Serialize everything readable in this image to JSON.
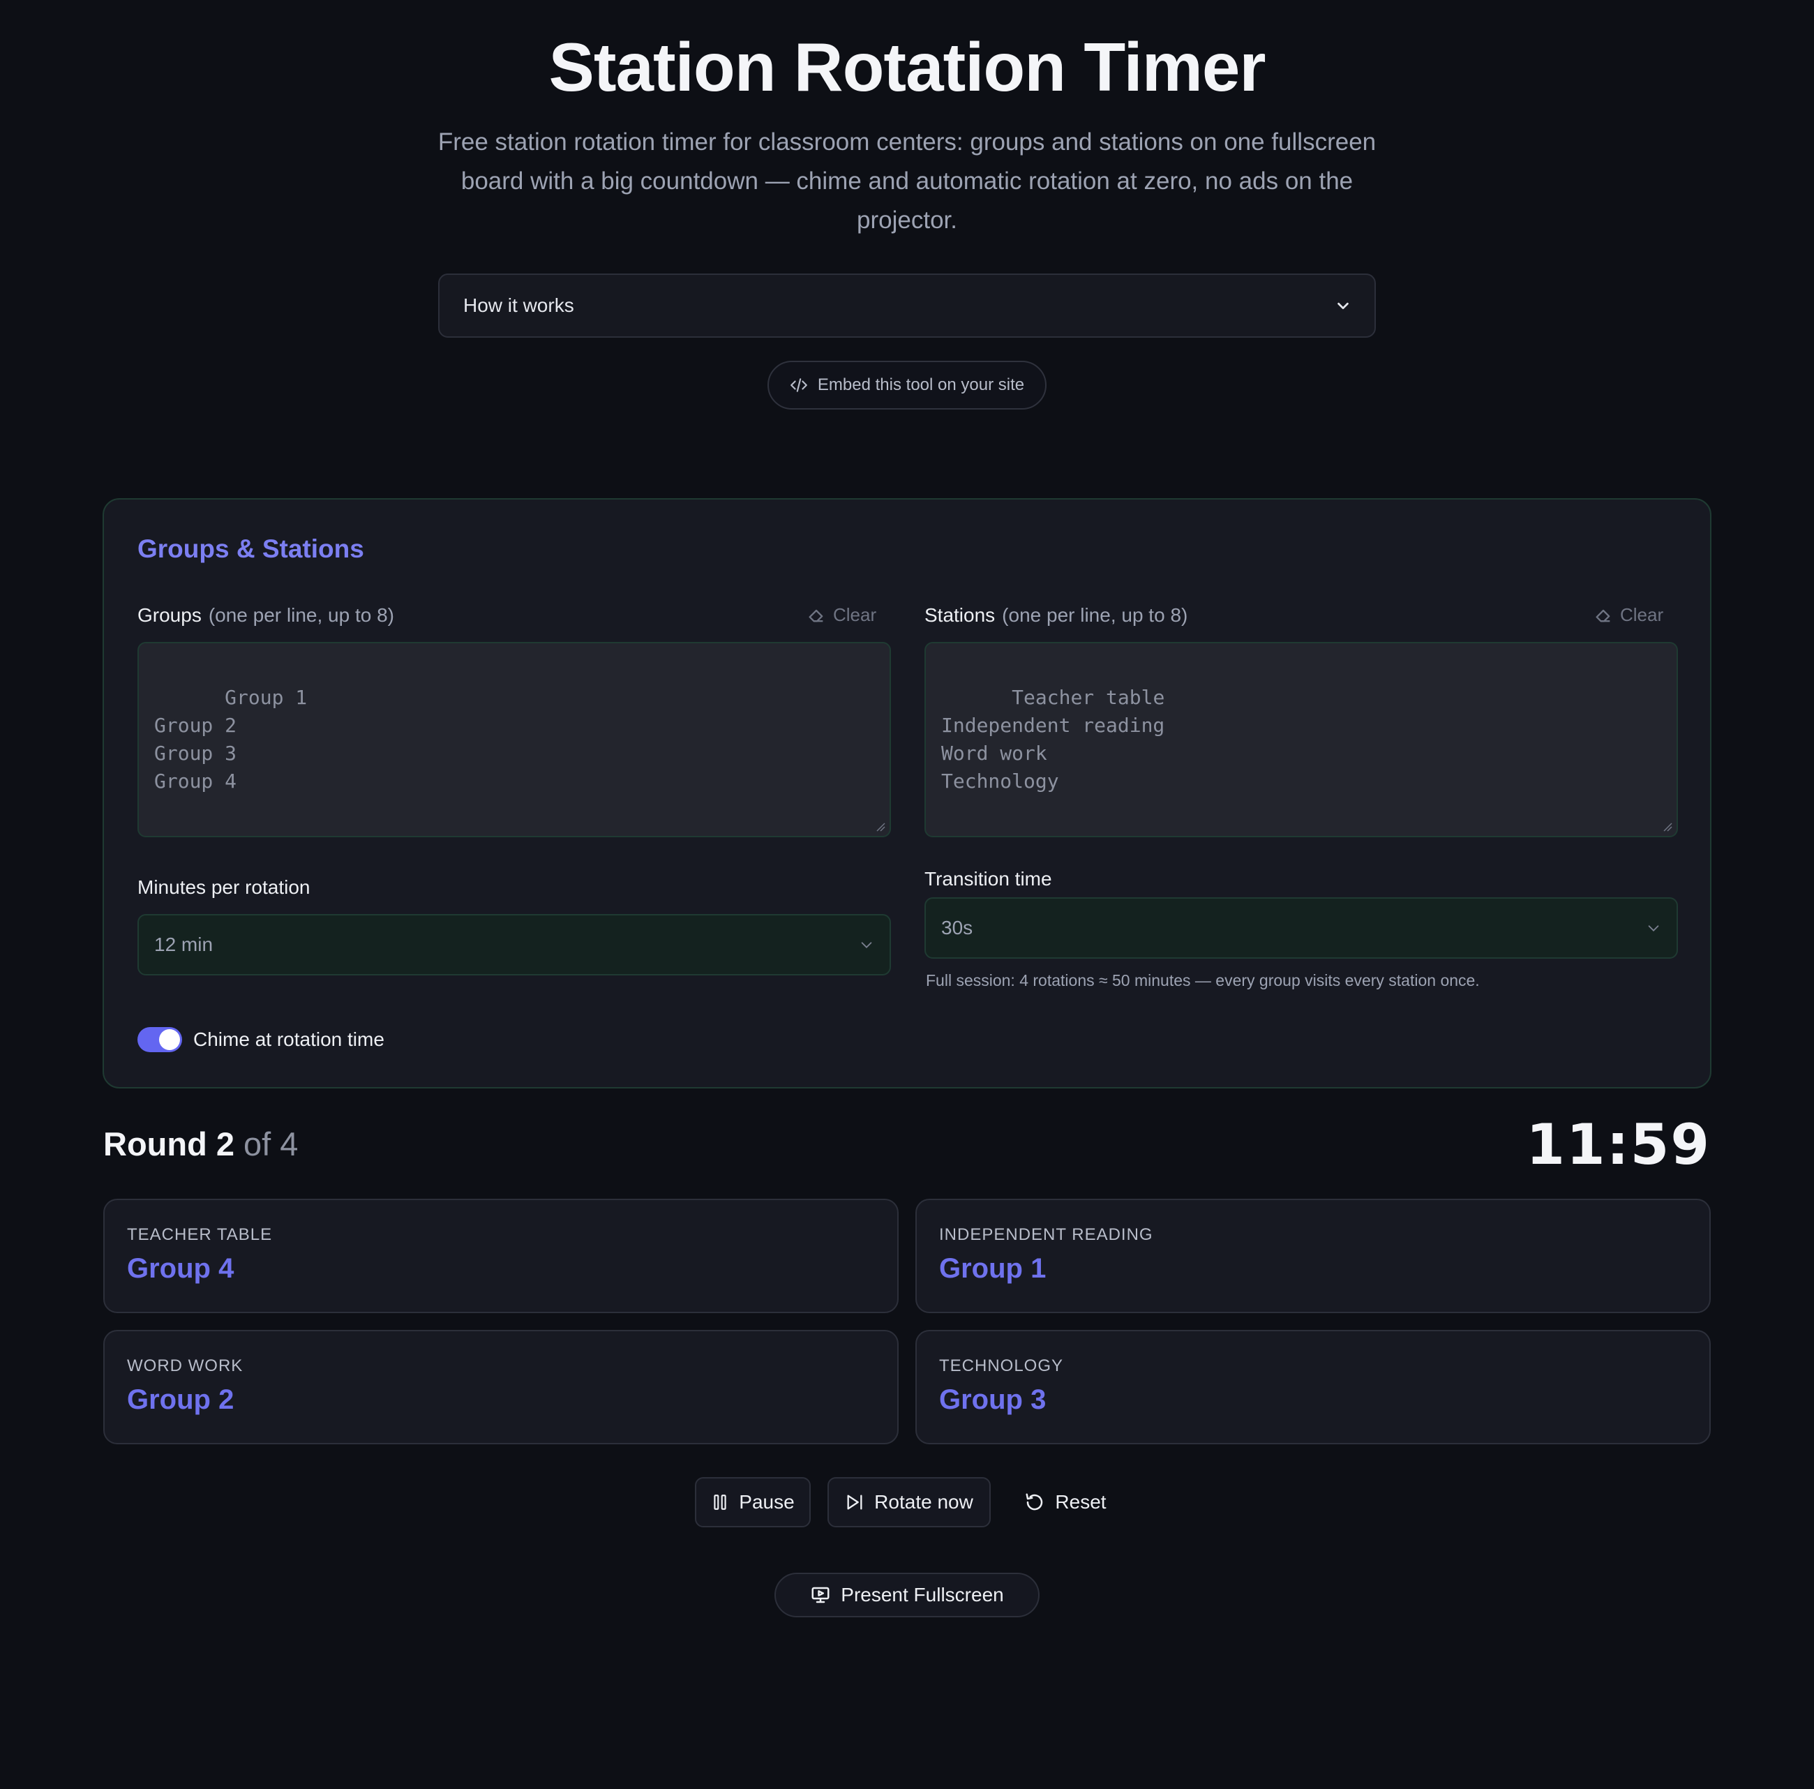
{
  "header": {
    "title": "Station Rotation Timer",
    "subtitle": "Free station rotation timer for classroom centers: groups and stations on one fullscreen board with a big countdown — chime and automatic rotation at zero, no ads on the projector."
  },
  "how_it_works": {
    "label": "How it works"
  },
  "embed": {
    "label": "Embed this tool on your site"
  },
  "panel": {
    "title": "Groups & Stations",
    "groups": {
      "label": "Groups",
      "hint": "(one per line, up to 8)",
      "clear_label": "Clear",
      "value": "Group 1\nGroup 2\nGroup 3\nGroup 4"
    },
    "stations": {
      "label": "Stations",
      "hint": "(one per line, up to 8)",
      "clear_label": "Clear",
      "value": "Teacher table\nIndependent reading\nWord work\nTechnology"
    },
    "minutes": {
      "label": "Minutes per rotation",
      "value": "12 min"
    },
    "transition": {
      "label": "Transition time",
      "value": "30s"
    },
    "session_note": "Full session: 4 rotations ≈ 50 minutes — every group visits every station once.",
    "chime": {
      "label": "Chime at rotation time",
      "enabled": true
    }
  },
  "round": {
    "prefix": "Round",
    "current": "2",
    "of_text": "of 4"
  },
  "countdown": {
    "value": "11:59"
  },
  "assignments": [
    {
      "station": "Teacher table",
      "group": "Group 4"
    },
    {
      "station": "Independent reading",
      "group": "Group 1"
    },
    {
      "station": "Word work",
      "group": "Group 2"
    },
    {
      "station": "Technology",
      "group": "Group 3"
    }
  ],
  "controls": {
    "pause_label": "Pause",
    "rotate_label": "Rotate now",
    "reset_label": "Reset",
    "present_label": "Present Fullscreen"
  },
  "colors": {
    "background": "#0d0f15",
    "accent": "#6f72ee",
    "panel_border": "#1f3a32"
  }
}
